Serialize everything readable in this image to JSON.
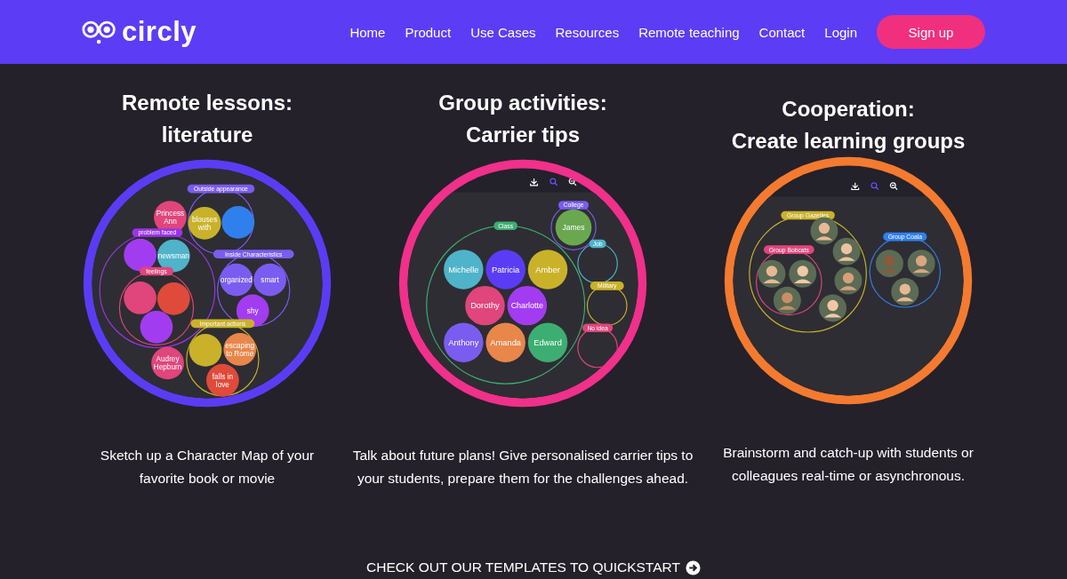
{
  "nav": {
    "brand": "circly",
    "links": [
      "Home",
      "Product",
      "Use Cases",
      "Resources",
      "Remote teaching",
      "Contact",
      "Login"
    ],
    "signup": "Sign up"
  },
  "cards": [
    {
      "title": [
        "Remote lessons:",
        "literature"
      ],
      "color": "#5b3cf5",
      "toolbar": false,
      "description": "Sketch up a Character Map of your favorite book or movie",
      "nodes": [
        {
          "kind": "group",
          "label": "Outside appearance",
          "color": "#7b5cf0",
          "children": [
            {
              "kind": "bubble",
              "lines": [
                "blouses",
                "with"
              ],
              "color": "#c9b22a"
            },
            {
              "kind": "bubble",
              "color": "#2f80ed"
            }
          ]
        },
        {
          "kind": "bubble",
          "lines": [
            "Princess",
            "Ann"
          ],
          "color": "#e0457b"
        },
        {
          "kind": "group",
          "label": "problem faced",
          "color": "#9b34e8",
          "children": [
            {
              "kind": "bubble",
              "color": "#a23cf0"
            },
            {
              "kind": "bubble",
              "lines": [
                "newsman"
              ],
              "color": "#4fb3c9"
            },
            {
              "kind": "group",
              "label": "feelings",
              "color": "#e0457b",
              "children": [
                {
                  "kind": "bubble",
                  "color": "#e0457b"
                },
                {
                  "kind": "bubble",
                  "color": "#e04a3a"
                },
                {
                  "kind": "bubble",
                  "color": "#a23cf0"
                }
              ]
            }
          ]
        },
        {
          "kind": "group",
          "label": "Inside Characteristics",
          "color": "#7b5cf0",
          "children": [
            {
              "kind": "bubble",
              "lines": [
                "organized"
              ],
              "color": "#7b5cf0"
            },
            {
              "kind": "bubble",
              "lines": [
                "smart"
              ],
              "color": "#7b5cf0"
            },
            {
              "kind": "bubble",
              "lines": [
                "shy"
              ],
              "color": "#a23cf0"
            }
          ]
        },
        {
          "kind": "group",
          "label": "Important actions",
          "color": "#c9b22a",
          "children": [
            {
              "kind": "bubble",
              "color": "#c9b22a"
            },
            {
              "kind": "bubble",
              "lines": [
                "escaping",
                "to Rome"
              ],
              "color": "#e9864a"
            },
            {
              "kind": "bubble",
              "lines": [
                "falls in",
                "love"
              ],
              "color": "#e04a3a"
            }
          ]
        },
        {
          "kind": "bubble",
          "lines": [
            "Audrey",
            "Hepburn"
          ],
          "color": "#e0457b"
        }
      ]
    },
    {
      "title": [
        "Group activities:",
        "Carrier tips"
      ],
      "color": "#f0308a",
      "toolbar": true,
      "description": "Talk about future plans! Give personalised carrier tips to your students, prepare them for the challenges ahead.",
      "nodes": [
        {
          "kind": "group",
          "label": "Class",
          "color": "#3dae72",
          "children": [
            {
              "kind": "bubble",
              "lines": [
                "Michelle"
              ],
              "color": "#4fb3c9"
            },
            {
              "kind": "bubble",
              "lines": [
                "Patricia"
              ],
              "color": "#5b3cf5"
            },
            {
              "kind": "bubble",
              "lines": [
                "Amber"
              ],
              "color": "#c9b22a"
            },
            {
              "kind": "bubble",
              "lines": [
                "Dorothy"
              ],
              "color": "#e0457b"
            },
            {
              "kind": "bubble",
              "lines": [
                "Charlotte"
              ],
              "color": "#a23cf0"
            },
            {
              "kind": "bubble",
              "lines": [
                "Anthony"
              ],
              "color": "#7b5cf0"
            },
            {
              "kind": "bubble",
              "lines": [
                "Amanda"
              ],
              "color": "#e9864a"
            },
            {
              "kind": "bubble",
              "lines": [
                "Edward"
              ],
              "color": "#3dae72"
            }
          ]
        },
        {
          "kind": "group",
          "label": "College",
          "color": "#7b5cf0",
          "children": [
            {
              "kind": "bubble",
              "lines": [
                "James"
              ],
              "color": "#6aa84f"
            }
          ]
        },
        {
          "kind": "group",
          "label": "Job",
          "color": "#4fb3c9"
        },
        {
          "kind": "group",
          "label": "Military",
          "color": "#c9b22a"
        },
        {
          "kind": "group",
          "label": "No idea",
          "color": "#e0457b"
        }
      ]
    },
    {
      "title": [
        "Cooperation:",
        "Create learning groups"
      ],
      "color": "#f47a30",
      "toolbar": true,
      "description": "Brainstorm and catch-up with students or colleagues real-time or asynchronous.",
      "nodes": [
        {
          "kind": "group",
          "label": "Group Gazelles",
          "color": "#c9b22a",
          "children": [
            {
              "kind": "group",
              "label": "Group Bobcats",
              "color": "#e0457b",
              "children": [
                {
                  "kind": "avatar"
                },
                {
                  "kind": "avatar"
                },
                {
                  "kind": "avatar"
                }
              ]
            },
            {
              "kind": "avatar"
            },
            {
              "kind": "avatar"
            },
            {
              "kind": "avatar"
            },
            {
              "kind": "avatar"
            }
          ]
        },
        {
          "kind": "group",
          "label": "Group Coala",
          "color": "#2f80ed",
          "children": [
            {
              "kind": "avatar"
            },
            {
              "kind": "avatar"
            },
            {
              "kind": "avatar"
            }
          ]
        }
      ]
    }
  ],
  "cta": "CHECK OUT OUR TEMPLATES TO QUICKSTART"
}
